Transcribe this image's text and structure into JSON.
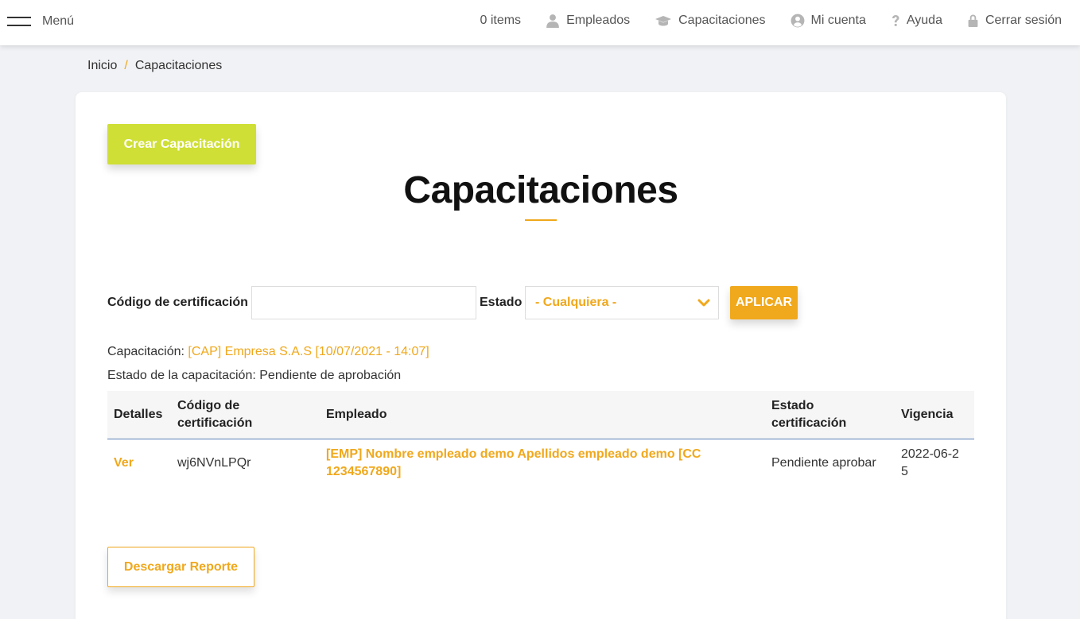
{
  "navbar": {
    "menu_label": "Menú",
    "items": [
      {
        "label": "0 items",
        "icon": ""
      },
      {
        "label": "Empleados",
        "icon": "user-icon"
      },
      {
        "label": "Capacitaciones",
        "icon": "graduation-cap-icon"
      },
      {
        "label": "Mi cuenta",
        "icon": "account-circle-icon"
      },
      {
        "label": "Ayuda",
        "icon": "question-icon"
      },
      {
        "label": "Cerrar sesión",
        "icon": "lock-icon"
      }
    ]
  },
  "breadcrumb": {
    "home": "Inicio",
    "separator": "/",
    "current": "Capacitaciones"
  },
  "main": {
    "create_button": "Crear Capacitación",
    "title": "Capacitaciones",
    "filters": {
      "code_label": "Código de certificación",
      "code_value": "",
      "status_label": "Estado",
      "status_value": "- Cualquiera -",
      "apply_button": "APLICAR"
    },
    "training_prefix": "Capacitación:",
    "training_value": "[CAP] Empresa S.A.S [10/07/2021 - 14:07]",
    "status_prefix": "Estado de la capacitación:",
    "status_value": "Pendiente de aprobación",
    "table": {
      "headers": [
        "Detalles",
        "Código de certificación",
        "Empleado",
        "Estado certificación",
        "Vigencia"
      ],
      "rows": [
        {
          "detalles": "Ver",
          "codigo": "wj6NVnLPQr",
          "empleado": "[EMP] Nombre empleado demo Apellidos empleado demo [CC 1234567890]",
          "estado": "Pendiente aprobar",
          "vigencia": "2022-06-25"
        }
      ]
    },
    "report_button": "Descargar Reporte"
  },
  "colors": {
    "accent": "#f0a81c",
    "create_button": "#cfdf36",
    "background": "#f1f2f5"
  }
}
